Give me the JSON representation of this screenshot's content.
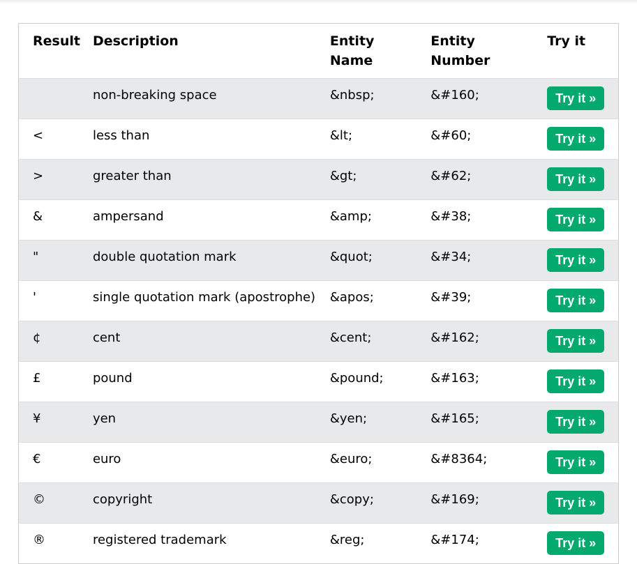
{
  "headers": {
    "result": "Result",
    "description": "Description",
    "entity_name_line1": "Entity",
    "entity_name_line2": "Name",
    "entity_number_line1": "Entity",
    "entity_number_line2": "Number",
    "try_it": "Try it"
  },
  "button_label": "Try it »",
  "colors": {
    "button_bg": "#04aa6d",
    "alt_row_bg": "#e7e9eb"
  },
  "rows": [
    {
      "result": "",
      "description": "non-breaking space",
      "entity_name": "&nbsp;",
      "entity_number": "&#160;"
    },
    {
      "result": "<",
      "description": "less than",
      "entity_name": "&lt;",
      "entity_number": "&#60;"
    },
    {
      "result": ">",
      "description": "greater than",
      "entity_name": "&gt;",
      "entity_number": "&#62;"
    },
    {
      "result": "&",
      "description": "ampersand",
      "entity_name": "&amp;",
      "entity_number": "&#38;"
    },
    {
      "result": "\"",
      "description": "double quotation mark",
      "entity_name": "&quot;",
      "entity_number": "&#34;"
    },
    {
      "result": "'",
      "description": "single quotation mark (apostrophe)",
      "entity_name": "&apos;",
      "entity_number": "&#39;"
    },
    {
      "result": "¢",
      "description": "cent",
      "entity_name": "&cent;",
      "entity_number": "&#162;"
    },
    {
      "result": "£",
      "description": "pound",
      "entity_name": "&pound;",
      "entity_number": "&#163;"
    },
    {
      "result": "¥",
      "description": "yen",
      "entity_name": "&yen;",
      "entity_number": "&#165;"
    },
    {
      "result": "€",
      "description": "euro",
      "entity_name": "&euro;",
      "entity_number": "&#8364;"
    },
    {
      "result": "©",
      "description": "copyright",
      "entity_name": "&copy;",
      "entity_number": "&#169;"
    },
    {
      "result": "®",
      "description": "registered trademark",
      "entity_name": "&reg;",
      "entity_number": "&#174;"
    }
  ]
}
